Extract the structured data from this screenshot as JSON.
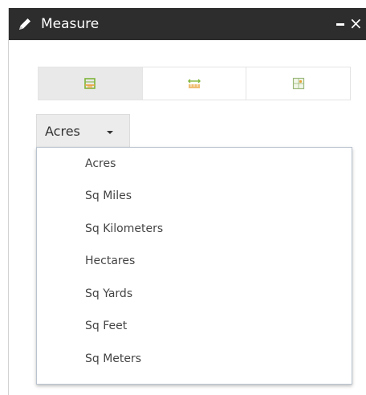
{
  "window": {
    "title": "Measure",
    "minimize_label": "minimize",
    "close_label": "×"
  },
  "toolbar": {
    "tools": [
      {
        "icon": "area-measure-icon",
        "active": true
      },
      {
        "icon": "distance-measure-icon",
        "active": false
      },
      {
        "icon": "location-measure-icon",
        "active": false
      }
    ]
  },
  "unit_select": {
    "selected": "Acres",
    "options": [
      "Acres",
      "Sq Miles",
      "Sq Kilometers",
      "Hectares",
      "Sq Yards",
      "Sq Feet",
      "Sq Meters"
    ]
  },
  "colors": {
    "titlebar": "#2d2d2d",
    "active_tool": "#e9e9e9",
    "icon_green": "#7fb539",
    "icon_orange": "#e9a23a"
  }
}
